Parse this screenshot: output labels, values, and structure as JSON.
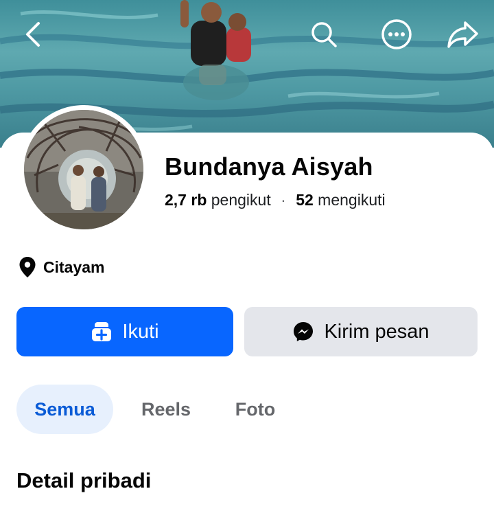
{
  "header": {
    "back_icon": "chevron-left-icon",
    "search_icon": "search-icon",
    "more_icon": "more-horizontal-icon",
    "share_icon": "share-arrow-icon"
  },
  "profile": {
    "name": "Bundanya Aisyah",
    "followers_count": "2,7 rb",
    "followers_label": "pengikut",
    "separator": "·",
    "following_count": "52",
    "following_label": "mengikuti"
  },
  "location": {
    "icon": "location-pin-icon",
    "text": "Citayam"
  },
  "actions": {
    "follow_label": "Ikuti",
    "follow_icon": "add-friend-icon",
    "message_label": "Kirim pesan",
    "message_icon": "messenger-icon"
  },
  "tabs": [
    {
      "label": "Semua",
      "active": true
    },
    {
      "label": "Reels",
      "active": false
    },
    {
      "label": "Foto",
      "active": false
    }
  ],
  "sections": {
    "personal_details_title": "Detail pribadi"
  },
  "colors": {
    "primary": "#0866ff",
    "secondary_button": "#e4e6eb",
    "active_tab_bg": "#e7f0fd",
    "active_tab_text": "#0a5bd6",
    "muted_text": "#65676b"
  }
}
